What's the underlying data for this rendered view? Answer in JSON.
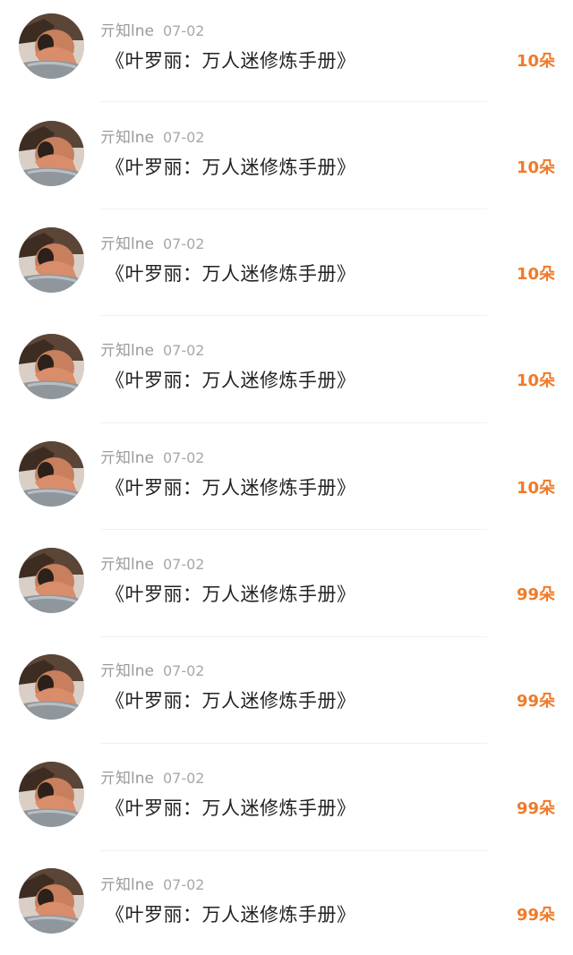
{
  "colors": {
    "accent": "#f07a28",
    "meta_text": "#9a9a9a",
    "primary_text": "#222222"
  },
  "comments": [
    {
      "username": "亓知lne",
      "date": "07-02",
      "text": "《叶罗丽：万人迷修炼手册》",
      "gift": "10朵",
      "avatar_icon": "user-avatar"
    },
    {
      "username": "亓知lne",
      "date": "07-02",
      "text": "《叶罗丽：万人迷修炼手册》",
      "gift": "10朵",
      "avatar_icon": "user-avatar"
    },
    {
      "username": "亓知lne",
      "date": "07-02",
      "text": "《叶罗丽：万人迷修炼手册》",
      "gift": "10朵",
      "avatar_icon": "user-avatar"
    },
    {
      "username": "亓知lne",
      "date": "07-02",
      "text": "《叶罗丽：万人迷修炼手册》",
      "gift": "10朵",
      "avatar_icon": "user-avatar"
    },
    {
      "username": "亓知lne",
      "date": "07-02",
      "text": "《叶罗丽：万人迷修炼手册》",
      "gift": "10朵",
      "avatar_icon": "user-avatar"
    },
    {
      "username": "亓知lne",
      "date": "07-02",
      "text": "《叶罗丽：万人迷修炼手册》",
      "gift": "99朵",
      "avatar_icon": "user-avatar"
    },
    {
      "username": "亓知lne",
      "date": "07-02",
      "text": "《叶罗丽：万人迷修炼手册》",
      "gift": "99朵",
      "avatar_icon": "user-avatar"
    },
    {
      "username": "亓知lne",
      "date": "07-02",
      "text": "《叶罗丽：万人迷修炼手册》",
      "gift": "99朵",
      "avatar_icon": "user-avatar"
    },
    {
      "username": "亓知lne",
      "date": "07-02",
      "text": "《叶罗丽：万人迷修炼手册》",
      "gift": "99朵",
      "avatar_icon": "user-avatar"
    }
  ]
}
